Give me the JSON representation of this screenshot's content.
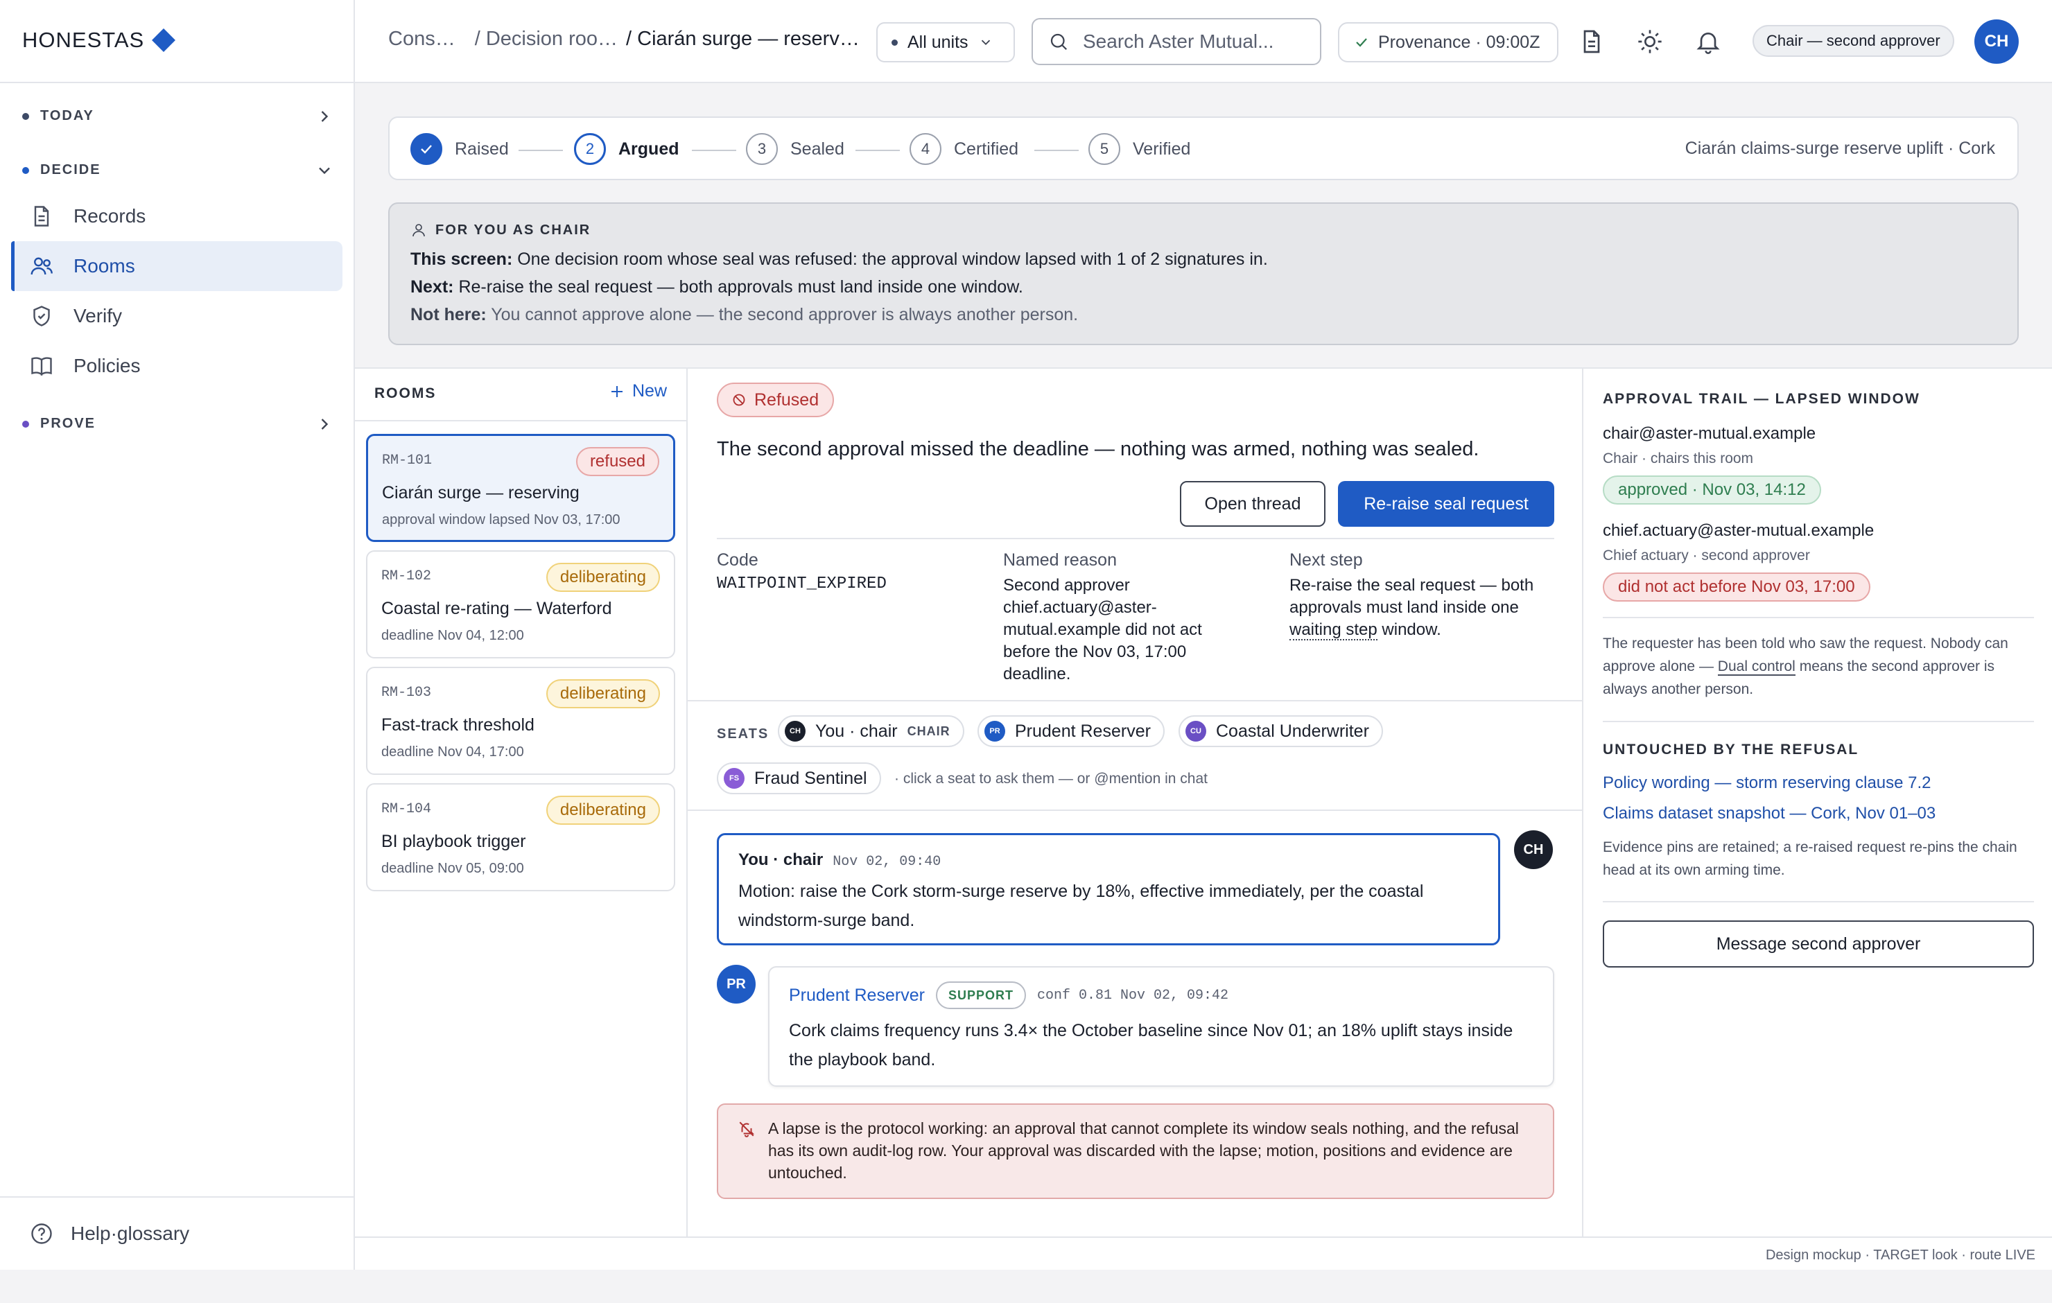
{
  "brand": "HONESTAS",
  "colors": {
    "accent": "#1f5bc4",
    "refused": "#b03030",
    "approved": "#2e7d4f"
  },
  "sidebar": {
    "sections": [
      {
        "label": "TODAY",
        "dot": "#3d4a66"
      },
      {
        "label": "DECIDE",
        "dot": "#1f5bc4"
      },
      {
        "label": "PROVE",
        "dot": "#6a4fc4"
      }
    ],
    "items": [
      {
        "label": "Records",
        "icon": "document-icon"
      },
      {
        "label": "Rooms",
        "icon": "users-icon"
      },
      {
        "label": "Verify",
        "icon": "shield-check-icon"
      },
      {
        "label": "Policies",
        "icon": "book-icon"
      }
    ],
    "help": "Help·glossary"
  },
  "topbar": {
    "crumbs": [
      "Cons…",
      "/ Decision roo…",
      "/ Ciarán surge — reserv…"
    ],
    "units": "All units",
    "search_placeholder": "Search Aster Mutual...",
    "provenance": "Provenance · 09:00Z",
    "role": "Chair — second approver",
    "avatar": "CH"
  },
  "stepper": {
    "steps": [
      {
        "num": "",
        "label": "Raised",
        "state": "done"
      },
      {
        "num": "2",
        "label": "Argued",
        "state": "current"
      },
      {
        "num": "3",
        "label": "Sealed",
        "state": "todo"
      },
      {
        "num": "4",
        "label": "Certified",
        "state": "todo"
      },
      {
        "num": "5",
        "label": "Verified",
        "state": "todo"
      }
    ],
    "context": "Ciarán claims-surge reserve uplift · Cork"
  },
  "chair": {
    "title": "FOR YOU AS CHAIR",
    "this_label": "This screen:",
    "this_text": "One decision room whose seal was refused: the approval window lapsed with 1 of 2 signatures in.",
    "next_label": "Next:",
    "next_text": "Re-raise the seal request — both approvals must land inside one window.",
    "not_label": "Not here:",
    "not_text": "You cannot approve alone — the second approver is always another person."
  },
  "rooms": {
    "title": "ROOMS",
    "new_label": "New",
    "list": [
      {
        "id": "RM-101",
        "title": "Ciarán surge — reserving",
        "detail": "approval window lapsed Nov 03, 17:00",
        "status": "refused"
      },
      {
        "id": "RM-102",
        "title": "Coastal re-rating — Waterford",
        "detail": "deadline Nov 04, 12:00",
        "status": "deliberating"
      },
      {
        "id": "RM-103",
        "title": "Fast-track threshold",
        "detail": "deadline Nov 04, 17:00",
        "status": "deliberating"
      },
      {
        "id": "RM-104",
        "title": "BI playbook trigger",
        "detail": "deadline Nov 05, 09:00",
        "status": "deliberating"
      }
    ]
  },
  "detail": {
    "status": "Refused",
    "headline": "The second approval missed the deadline — nothing was armed, nothing was sealed.",
    "open_thread": "Open thread",
    "reraise": "Re-raise seal request",
    "code_label": "Code",
    "code": "WAITPOINT_EXPIRED",
    "reason_label": "Named reason",
    "reason": "Second approver chief.actuary@aster-mutual.example did not act before the Nov 03, 17:00 deadline.",
    "next_label": "Next step",
    "next_pre": "Re-raise the seal request — both approvals must land inside one",
    "next_link": "waiting step",
    "next_post": "window."
  },
  "seats": {
    "label": "SEATS",
    "list": [
      {
        "initials": "CH",
        "name": "You · chair",
        "tag": "CHAIR",
        "color": "#1a1f2b"
      },
      {
        "initials": "PR",
        "name": "Prudent Reserver",
        "tag": "",
        "color": "#1f5bc4"
      },
      {
        "initials": "CU",
        "name": "Coastal Underwriter",
        "tag": "",
        "color": "#6a4fc4"
      },
      {
        "initials": "FS",
        "name": "Fraud Sentinel",
        "tag": "",
        "color": "#8a5cd6"
      }
    ],
    "hint": "· click a seat to ask them — or @mention in chat"
  },
  "thread": {
    "msg1": {
      "author": "You · chair",
      "time": "Nov 02, 09:40",
      "avatar": "CH",
      "text": "Motion: raise the Cork storm-surge reserve by 18%, effective immediately, per the coastal windstorm-surge band."
    },
    "msg2": {
      "author": "Prudent Reserver",
      "tag": "SUPPORT",
      "meta": "conf 0.81 Nov 02, 09:42",
      "avatar": "PR",
      "text": "Cork claims frequency runs 3.4× the October baseline since Nov 01; an 18% uplift stays inside the playbook band."
    },
    "alert": "A lapse is the protocol working: an approval that cannot complete its window seals nothing, and the refusal has its own audit-log row. Your approval was discarded with the lapse; motion, positions and evidence are untouched."
  },
  "trail": {
    "title": "APPROVAL TRAIL — LAPSED WINDOW",
    "a1_email": "chair@aster-mutual.example",
    "a1_role": "Chair · chairs this room",
    "a1_status": "approved · Nov 03, 14:12",
    "a2_email": "chief.actuary@aster-mutual.example",
    "a2_role": "Chief actuary · second approver",
    "a2_status": "did not act before Nov 03, 17:00",
    "note_pre": "The requester has been told who saw the request. Nobody can approve alone —",
    "note_link": "Dual control",
    "note_post": "means the second approver is always another person.",
    "untouched_title": "UNTOUCHED BY THE REFUSAL",
    "link1": "Policy wording — storm reserving clause 7.2",
    "link2": "Claims dataset snapshot — Cork, Nov 01–03",
    "evidence": "Evidence pins are retained; a re-raised request re-pins the chain head at its own arming time.",
    "message_btn": "Message second approver"
  },
  "footer": "Design mockup · TARGET look · route LIVE"
}
